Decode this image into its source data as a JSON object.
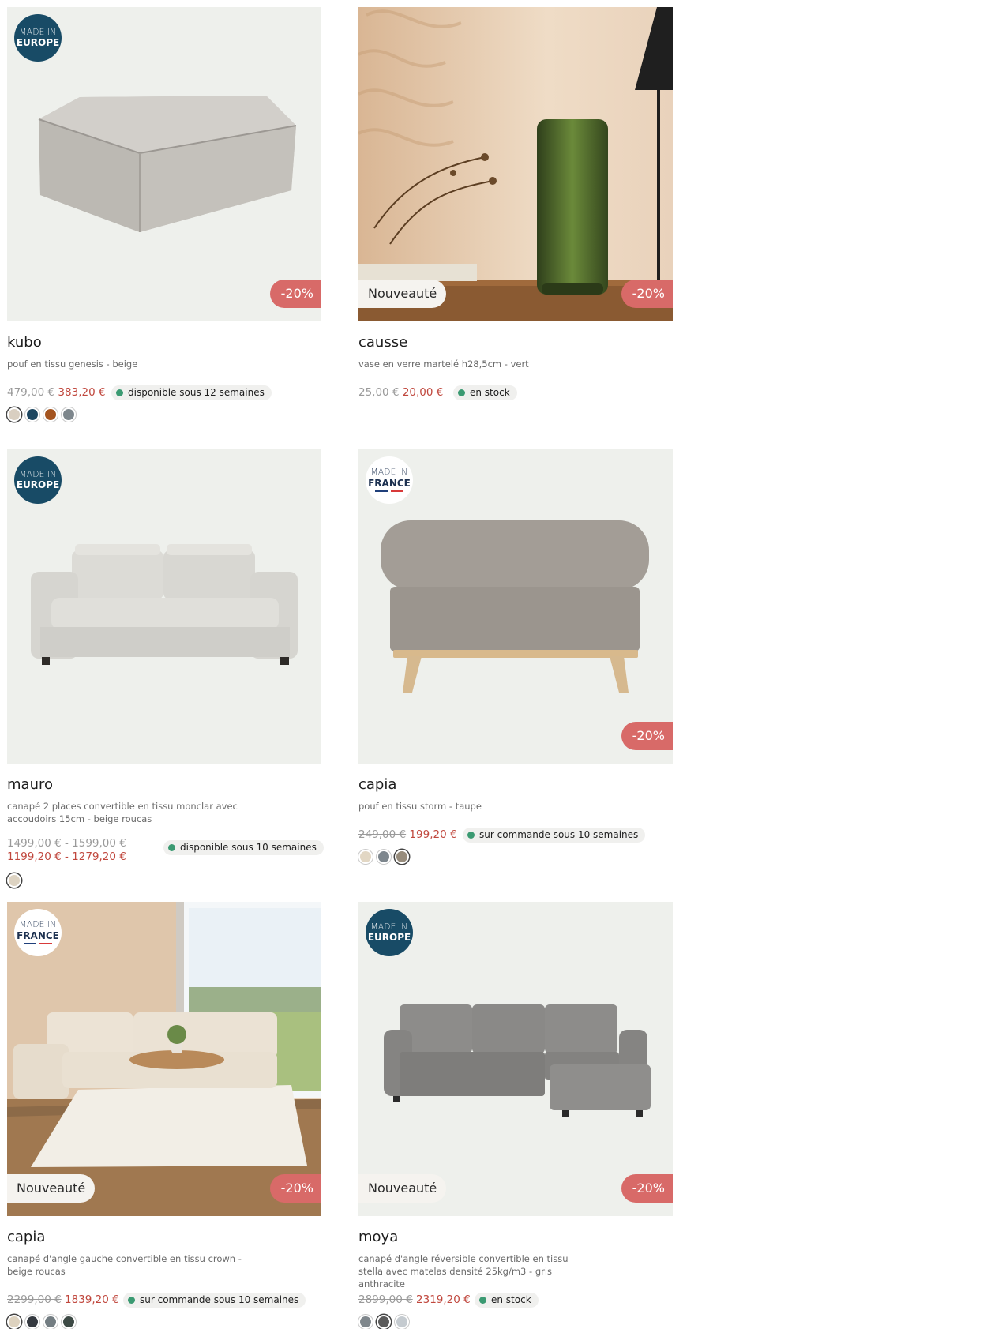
{
  "products": [
    {
      "name": "kubo",
      "description": "pouf en tissu genesis - beige",
      "badge": {
        "line1": "MADE IN",
        "line2": "EUROPE",
        "type": "europe"
      },
      "promo": "-20%",
      "old_price": "479,00 €",
      "new_price": "383,20 €",
      "stock": "disponible sous 12 semaines",
      "swatches": [
        "#d9cfc1",
        "#1d4660",
        "#a4541f",
        "#7d868c"
      ]
    },
    {
      "name": "causse",
      "description": "vase en verre martelé h28,5cm - vert",
      "new_tag": "Nouveauté",
      "promo": "-20%",
      "old_price": "25,00 €",
      "new_price": "20,00 €",
      "stock": "en stock",
      "swatches": []
    },
    {
      "name": "mauro",
      "description": "canapé 2 places convertible en tissu monclar avec accoudoirs 15cm - beige roucas",
      "badge": {
        "line1": "MADE IN",
        "line2": "EUROPE",
        "type": "europe"
      },
      "old_price": "1499,00 € - 1599,00 €",
      "new_price": "1199,20 € - 1279,20 €",
      "stock": "disponible sous 10 semaines",
      "swatches": [
        "#ddd3c2"
      ]
    },
    {
      "name": "capia",
      "description": "pouf en tissu storm - taupe",
      "badge": {
        "line1": "MADE IN",
        "line2": "FRANCE",
        "type": "france"
      },
      "promo": "-20%",
      "old_price": "249,00 €",
      "new_price": "199,20 €",
      "stock": "sur commande sous 10 semaines",
      "swatches": [
        "#e2d7c4",
        "#7d868d",
        "#978c7c"
      ]
    },
    {
      "name": "capia",
      "description": "canapé d'angle gauche convertible en tissu crown - beige roucas",
      "badge": {
        "line1": "MADE IN",
        "line2": "FRANCE",
        "type": "france"
      },
      "new_tag": "Nouveauté",
      "promo": "-20%",
      "old_price": "2299,00 €",
      "new_price": "1839,20 €",
      "stock": "sur commande sous 10 semaines",
      "swatches": [
        "#ddd2bf",
        "#343940",
        "#737d82",
        "#3d4a45"
      ]
    },
    {
      "name": "moya",
      "description": "canapé d'angle réversible convertible en tissu stella avec matelas densité 25kg/m3 - gris anthracite",
      "badge": {
        "line1": "MADE IN",
        "line2": "EUROPE",
        "type": "europe"
      },
      "new_tag": "Nouveauté",
      "promo": "-20%",
      "old_price": "2899,00 €",
      "new_price": "2319,20 €",
      "stock": "en stock",
      "swatches": [
        "#7f878c",
        "#5a5a5a",
        "#c5cbd0"
      ]
    }
  ]
}
